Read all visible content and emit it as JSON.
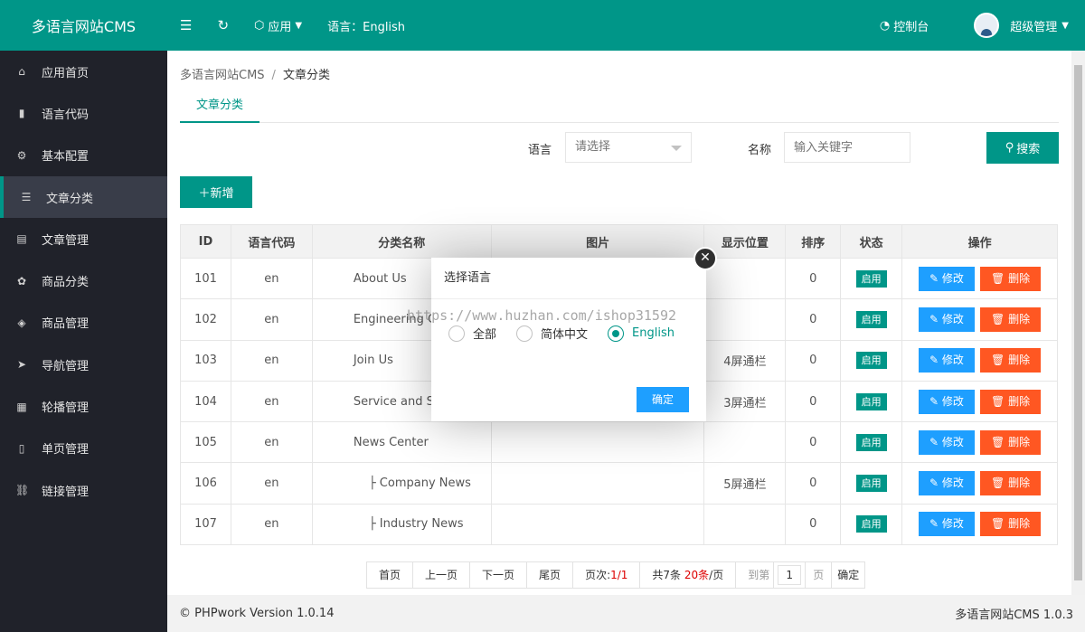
{
  "header": {
    "logo": "多语言网站CMS",
    "menu_icon": "☰",
    "refresh_icon": "↻",
    "apps_label": "应用",
    "language_label": "语言：English",
    "console_label": "控制台",
    "user_label": "超级管理"
  },
  "sidebar": {
    "items": [
      {
        "icon": "⌂",
        "label": "应用首页"
      },
      {
        "icon": "▮",
        "label": "语言代码"
      },
      {
        "icon": "⚙",
        "label": "基本配置"
      },
      {
        "icon": "☰",
        "label": "文章分类"
      },
      {
        "icon": "▤",
        "label": "文章管理"
      },
      {
        "icon": "✿",
        "label": "商品分类"
      },
      {
        "icon": "◈",
        "label": "商品管理"
      },
      {
        "icon": "➤",
        "label": "导航管理"
      },
      {
        "icon": "▦",
        "label": "轮播管理"
      },
      {
        "icon": "▯",
        "label": "单页管理"
      },
      {
        "icon": "⛓",
        "label": "链接管理"
      }
    ]
  },
  "breadcrumb": {
    "root": "多语言网站CMS",
    "sep": "/",
    "current": "文章分类"
  },
  "tab": {
    "label": "文章分类"
  },
  "filter": {
    "lang_label": "语言",
    "lang_select": "请选择",
    "name_label": "名称",
    "name_placeholder": "输入关键字",
    "search_label": "搜索"
  },
  "toolbar": {
    "add_label": "＋新增"
  },
  "table": {
    "headers": [
      "ID",
      "语言代码",
      "分类名称",
      "图片",
      "显示位置",
      "排序",
      "状态",
      "操作"
    ],
    "rows": [
      {
        "id": "101",
        "lang": "en",
        "name": "About Us",
        "img": "",
        "pos": "",
        "sort": "0",
        "status": "启用"
      },
      {
        "id": "102",
        "lang": "en",
        "name": "Engineering Ca",
        "img": "",
        "pos": "",
        "sort": "0",
        "status": "启用"
      },
      {
        "id": "103",
        "lang": "en",
        "name": "Join Us",
        "img": "",
        "pos": "4屏通栏",
        "sort": "0",
        "status": "启用"
      },
      {
        "id": "104",
        "lang": "en",
        "name": "Service and Su",
        "img": "",
        "pos": "3屏通栏",
        "sort": "0",
        "status": "启用"
      },
      {
        "id": "105",
        "lang": "en",
        "name": "News Center",
        "img": "",
        "pos": "",
        "sort": "0",
        "status": "启用"
      },
      {
        "id": "106",
        "lang": "en",
        "name": "├ Company News",
        "img": "",
        "pos": "5屏通栏",
        "sort": "0",
        "status": "启用"
      },
      {
        "id": "107",
        "lang": "en",
        "name": "├ Industry News",
        "img": "",
        "pos": "",
        "sort": "0",
        "status": "启用"
      }
    ],
    "edit_label": "修改",
    "delete_label": "删除"
  },
  "pager": {
    "first": "首页",
    "prev": "上一页",
    "next": "下一页",
    "last": "尾页",
    "page_label": "页次:",
    "page_value": "1/1",
    "total_prefix": "共7条",
    "per_page": "20条",
    "per_suffix": "/页",
    "goto_label": "到第",
    "goto_value": "1",
    "page_unit": "页",
    "confirm": "确定"
  },
  "footer": {
    "left": "© PHPwork Version 1.0.14",
    "right": "多语言网站CMS 1.0.3"
  },
  "modal": {
    "title": "选择语言",
    "options": [
      {
        "label": "全部",
        "checked": false
      },
      {
        "label": "简体中文",
        "checked": false
      },
      {
        "label": "English",
        "checked": true
      }
    ],
    "ok_label": "确定"
  },
  "watermark": "https://www.huzhan.com/ishop31592",
  "colors": {
    "primary": "#009688",
    "edit": "#1e9fff",
    "delete": "#ff5722",
    "sidebar": "#20222a"
  }
}
